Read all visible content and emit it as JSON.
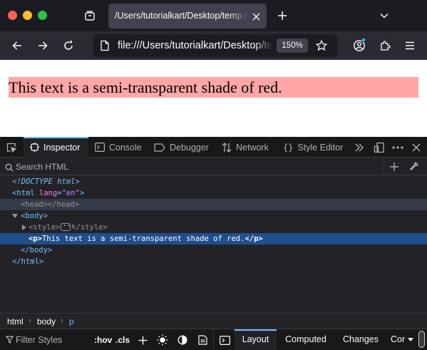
{
  "browser": {
    "tab": {
      "title": "/Users/tutorialkart/Desktop/temp.html"
    },
    "url": "file:///Users/tutorialkart/Desktop/temp.html",
    "zoom": "150%"
  },
  "page": {
    "paragraph": "This text is a semi-transparent shade of red.",
    "highlight_color": "rgba(255,0,0,0.35)"
  },
  "devtools": {
    "tools": [
      "Inspector",
      "Console",
      "Debugger",
      "Network",
      "Style Editor"
    ],
    "search_placeholder": "Search HTML",
    "markup": {
      "doctype": "<!DOCTYPE html>",
      "html_open": "<html",
      "html_attr_name": "lang",
      "html_attr_eq": "=",
      "html_attr_value": "\"en\"",
      "html_open_end": ">",
      "head": "<head></head>",
      "body_open": "<body>",
      "style_open": "<style>",
      "style_close": "</style>",
      "p_open": "<p>",
      "p_text": "This text is a semi-transparent shade of red.",
      "p_close": "</p>",
      "body_close": "</body>",
      "html_close": "</html>"
    },
    "breadcrumbs": [
      "html",
      "body",
      "p"
    ],
    "rules": {
      "filter_placeholder": "Filter Styles",
      "hov": ":hov",
      "cls": ".cls"
    },
    "panel_tabs": [
      "Layout",
      "Computed",
      "Changes",
      "Compatibility"
    ],
    "accent": "#75bfff"
  }
}
